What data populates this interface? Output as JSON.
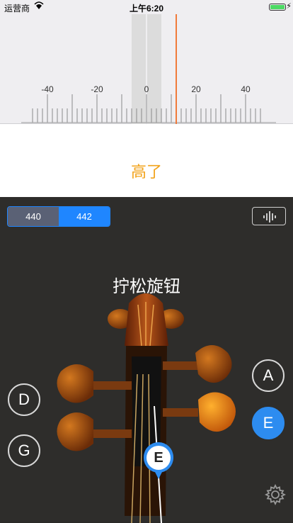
{
  "status_bar": {
    "carrier": "运营商",
    "time": "上午6:20"
  },
  "meter": {
    "scale_labels": [
      "-40",
      "-20",
      "0",
      "20",
      "40"
    ],
    "indicator_cents": 12,
    "indicator_color": "#f07a3a"
  },
  "result_text": "高了",
  "reference_pitch": {
    "options": [
      "440",
      "442"
    ],
    "selected": "442"
  },
  "instruction": "拧松旋钮",
  "strings": {
    "left": [
      "D",
      "G"
    ],
    "right": [
      "A",
      "E"
    ],
    "active": "E"
  },
  "current_note": "E",
  "colors": {
    "accent": "#1f86ff",
    "warning": "#f2a31b",
    "active_note": "#2d8cf0"
  }
}
